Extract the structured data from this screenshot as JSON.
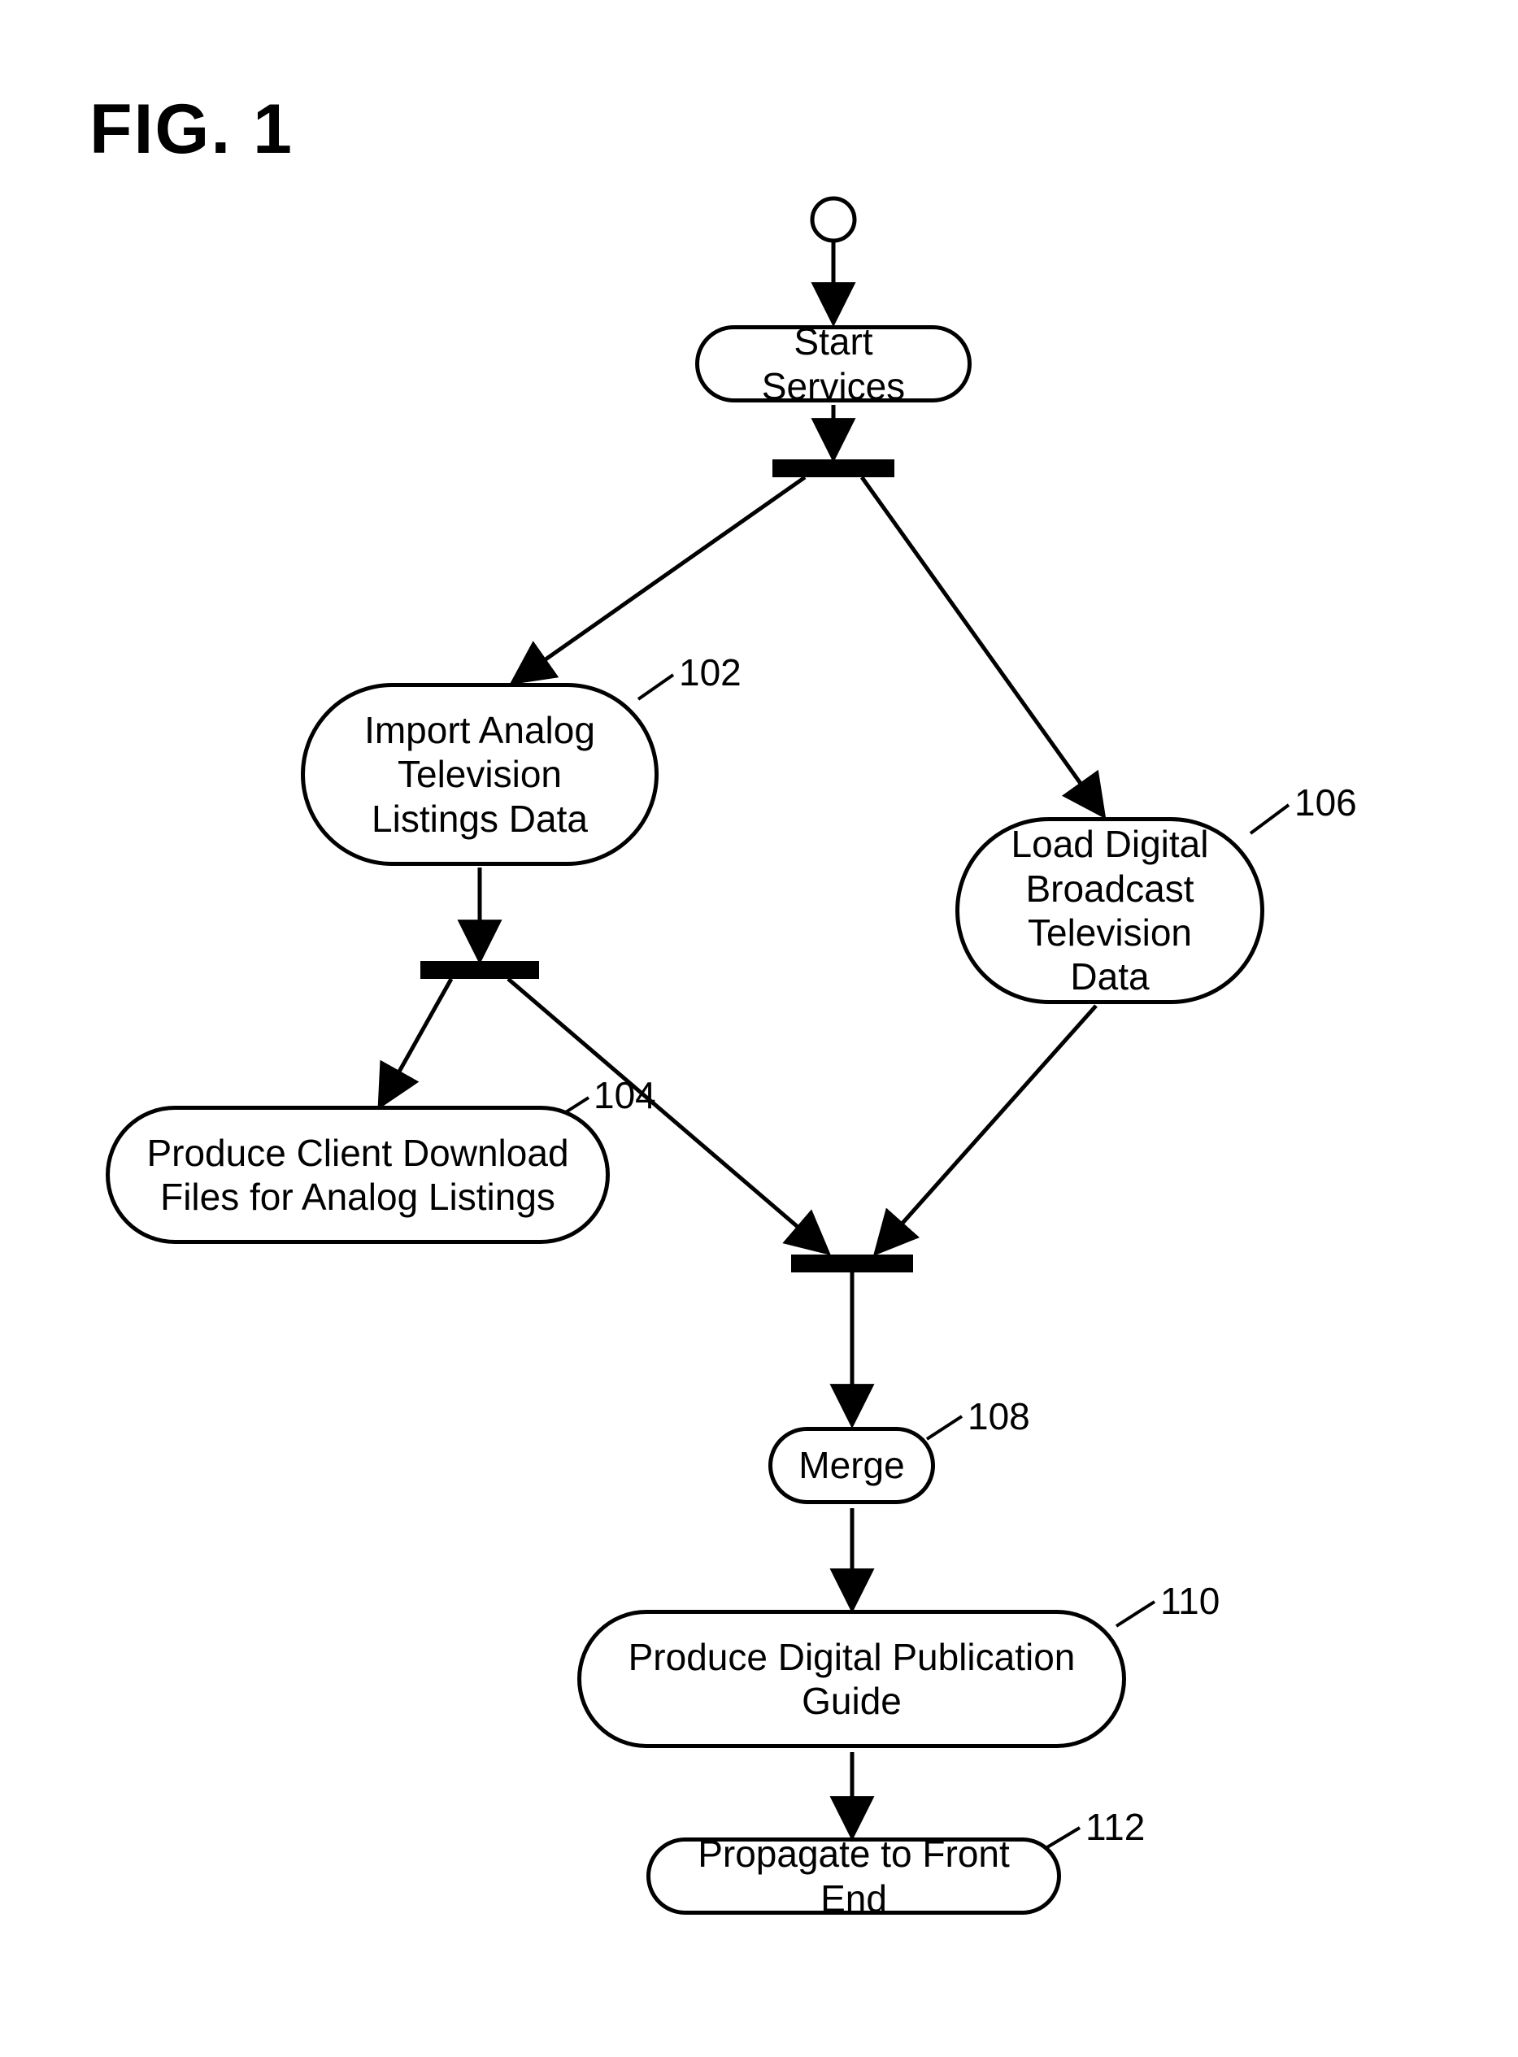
{
  "figure_title": "FIG. 1",
  "nodes": {
    "start": {
      "text": "Start Services"
    },
    "n102": {
      "text": "Import Analog Television Listings Data",
      "ref": "102"
    },
    "n104": {
      "text": "Produce Client Download Files for Analog Listings",
      "ref": "104"
    },
    "n106": {
      "text": "Load Digital Broadcast Television Data",
      "ref": "106"
    },
    "n108": {
      "text": "Merge",
      "ref": "108"
    },
    "n110": {
      "text": "Produce Digital Publication Guide",
      "ref": "110"
    },
    "n112": {
      "text": "Propagate to Front End",
      "ref": "112"
    }
  }
}
